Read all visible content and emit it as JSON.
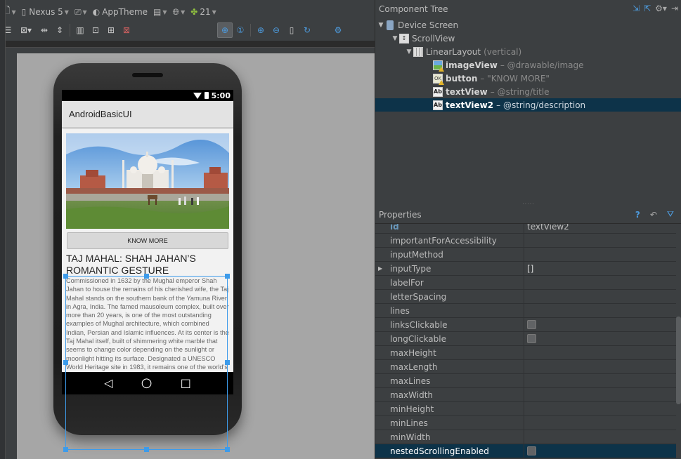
{
  "toolbar": {
    "device": "Nexus 5",
    "theme": "AppTheme",
    "api_level": "21"
  },
  "preview": {
    "status_time": "5:00",
    "app_title": "AndroidBasicUI",
    "button_label": "KNOW MORE",
    "title": "TAJ MAHAL: SHAH JAHAN’S ROMANTIC GESTURE",
    "description": "Commissioned in 1632 by the Mughal emperor Shah Jahan to house the remains of his cherished wife, the Taj Mahal stands on the southern bank of the Yamuna River in Agra, India. The famed mausoleum complex, built over more than 20 years, is one of the most outstanding examples of Mughal architecture, which combined Indian, Persian and Islamic influences. At its center is the Taj Mahal itself, built of shimmering white marble that seems to change color depending on the sunlight or moonlight hitting its surface. Designated a UNESCO World Heritage site in 1983, it remains one of the world’s most celebrated structures and a stunning"
  },
  "component_tree": {
    "header": "Component Tree",
    "nodes": [
      {
        "name": "Device Screen",
        "desc": ""
      },
      {
        "name": "ScrollView",
        "desc": ""
      },
      {
        "name": "LinearLayout",
        "desc": "(vertical)"
      },
      {
        "name": "imageView",
        "desc": "– @drawable/image"
      },
      {
        "name": "button",
        "desc": "– \"KNOW MORE\""
      },
      {
        "name": "textView",
        "desc": "– @string/title"
      },
      {
        "name": "textView2",
        "desc": "– @string/description"
      }
    ]
  },
  "properties": {
    "header": "Properties",
    "rows": [
      {
        "name": "id",
        "value": "textView2"
      },
      {
        "name": "importantForAccessibility",
        "value": ""
      },
      {
        "name": "inputMethod",
        "value": ""
      },
      {
        "name": "inputType",
        "value": "[]"
      },
      {
        "name": "labelFor",
        "value": ""
      },
      {
        "name": "letterSpacing",
        "value": ""
      },
      {
        "name": "lines",
        "value": ""
      },
      {
        "name": "linksClickable",
        "value": ""
      },
      {
        "name": "longClickable",
        "value": ""
      },
      {
        "name": "maxHeight",
        "value": ""
      },
      {
        "name": "maxLength",
        "value": ""
      },
      {
        "name": "maxLines",
        "value": ""
      },
      {
        "name": "maxWidth",
        "value": ""
      },
      {
        "name": "minHeight",
        "value": ""
      },
      {
        "name": "minLines",
        "value": ""
      },
      {
        "name": "minWidth",
        "value": ""
      },
      {
        "name": "nestedScrollingEnabled",
        "value": ""
      }
    ]
  },
  "icons": [
    "new-file-icon",
    "device-icon",
    "orientation-icon",
    "theme-icon",
    "activity-icon",
    "locale-icon",
    "android-icon",
    "gear-icon",
    "zoom-fit-icon",
    "zoom-actual-icon",
    "zoom-in-icon",
    "zoom-out-icon",
    "help-icon",
    "restore-default-icon",
    "filter-icon"
  ],
  "colors": {
    "ide_background": "#3c3f41",
    "selection_background": "#0d3349",
    "selection_outline": "#3d9bea"
  }
}
